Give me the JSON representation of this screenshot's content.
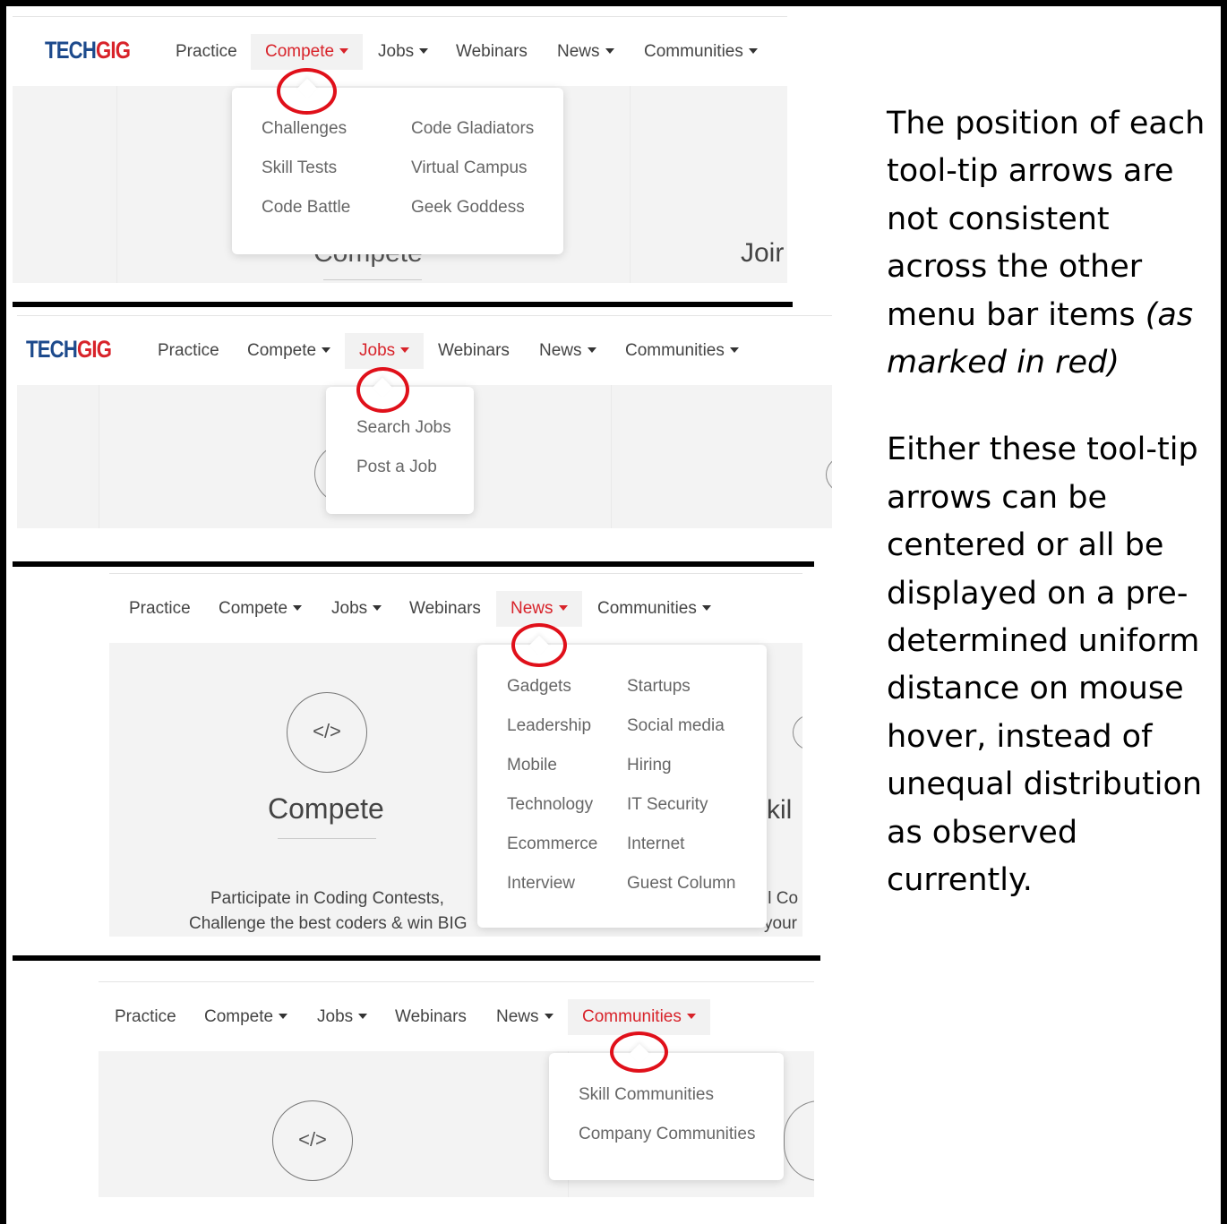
{
  "brand": {
    "part1": "TECH",
    "part2": "GIG"
  },
  "nav": {
    "practice": "Practice",
    "compete": "Compete",
    "jobs": "Jobs",
    "webinars": "Webinars",
    "news": "News",
    "communities": "Communities"
  },
  "dropdowns": {
    "compete": [
      "Challenges",
      "Code Gladiators",
      "Skill Tests",
      "Virtual Campus",
      "Code Battle",
      "Geek Goddess"
    ],
    "jobs": [
      "Search Jobs",
      "Post a Job"
    ],
    "news": [
      "Gadgets",
      "Startups",
      "Leadership",
      "Social media",
      "Mobile",
      "Hiring",
      "Technology",
      "IT Security",
      "Ecommerce",
      "Internet",
      "Interview",
      "Guest Column"
    ],
    "communities": [
      "Skill Communities",
      "Company Communities"
    ]
  },
  "background_text": {
    "panel1_left": "Compete",
    "panel1_right": "Joir",
    "panel3_title": "Compete",
    "panel3_line1": "Participate in Coding Contests,",
    "panel3_line2": "Challenge the best coders & win BIG",
    "panel3_right_title": "kil",
    "panel3_right_line1": "ll Co",
    "panel3_right_line2": "your",
    "code_icon": "</>"
  },
  "annotation": {
    "para1": "The position of each tool-tip arrows are not consistent across the other menu bar items",
    "para1_italic": "(as marked in red)",
    "para2": "Either these tool-tip arrows can be centered or all be displayed on a pre-determined uniform distance on mouse hover, instead of unequal distribution as observed currently."
  },
  "colors": {
    "brand_blue": "#1d4a8c",
    "brand_red": "#d8232a",
    "marker_red": "#e0101a"
  }
}
